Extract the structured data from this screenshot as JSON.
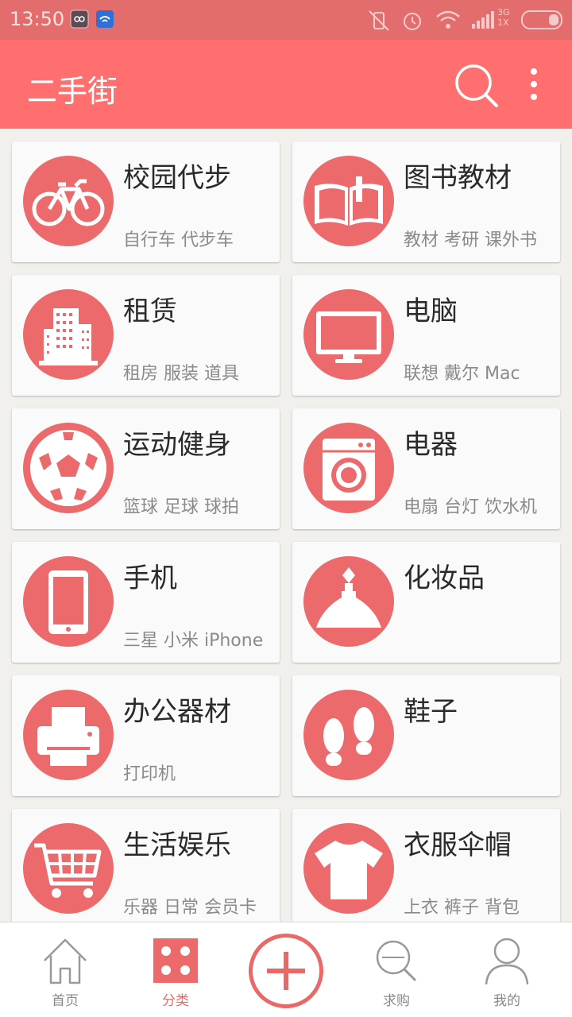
{
  "status_bar": {
    "time": "13:50",
    "network_3g": "3G",
    "network_1x": "1X",
    "icons": [
      "notification-icon",
      "wifi-app-icon",
      "vibrate-off-icon",
      "alarm-icon",
      "wifi-icon",
      "signal-icon",
      "battery-icon"
    ]
  },
  "app_bar": {
    "title": "二手街",
    "search_icon": "search-icon",
    "more_icon": "more-vert-icon"
  },
  "categories": [
    {
      "title": "校园代步",
      "subtitle": "自行车 代步车",
      "icon": "bicycle-icon"
    },
    {
      "title": "图书教材",
      "subtitle": "教材 考研 课外书",
      "icon": "book-icon"
    },
    {
      "title": "租赁",
      "subtitle": "租房 服装 道具",
      "icon": "building-icon"
    },
    {
      "title": "电脑",
      "subtitle": "联想 戴尔 Mac",
      "icon": "monitor-icon"
    },
    {
      "title": "运动健身",
      "subtitle": "篮球 足球 球拍",
      "icon": "soccer-ball-icon"
    },
    {
      "title": "电器",
      "subtitle": "电扇 台灯 饮水机",
      "icon": "washing-machine-icon"
    },
    {
      "title": "手机",
      "subtitle": "三星 小米 iPhone",
      "icon": "tablet-phone-icon"
    },
    {
      "title": "化妆品",
      "subtitle": "",
      "icon": "perfume-bottle-icon"
    },
    {
      "title": "办公器材",
      "subtitle": "打印机",
      "icon": "printer-icon"
    },
    {
      "title": "鞋子",
      "subtitle": "",
      "icon": "footprints-icon"
    },
    {
      "title": "生活娱乐",
      "subtitle": "乐器 日常 会员卡",
      "icon": "shopping-cart-icon"
    },
    {
      "title": "衣服伞帽",
      "subtitle": "上衣 裤子 背包",
      "icon": "tshirt-icon"
    }
  ],
  "tabs": [
    {
      "label": "首页",
      "icon": "home-icon",
      "active": false
    },
    {
      "label": "分类",
      "icon": "category-grid-icon",
      "active": true
    },
    {
      "label": "",
      "icon": "add-circle-icon",
      "active": false
    },
    {
      "label": "求购",
      "icon": "search-wanted-icon",
      "active": false
    },
    {
      "label": "我的",
      "icon": "profile-icon",
      "active": false
    }
  ],
  "colors": {
    "accent": "#ff6f6f",
    "icon_circle": "#ec6a6b",
    "status_bar": "#e36d6d",
    "background": "#f1f0ec"
  }
}
